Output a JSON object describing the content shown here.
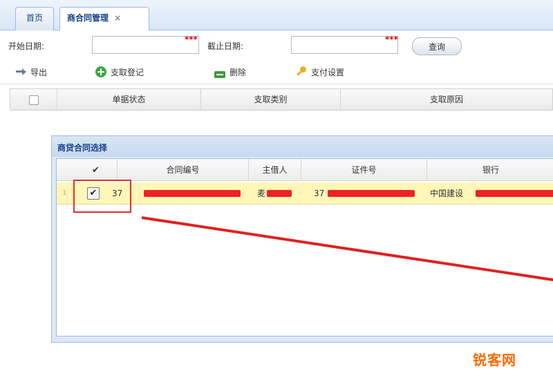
{
  "tabs": [
    {
      "label": "首页"
    },
    {
      "label": "商合同管理",
      "close": "×"
    }
  ],
  "search": {
    "start_label": "开始日期:",
    "end_label": "截止日期:",
    "start_value": "",
    "end_value": "",
    "required_mark": "***",
    "query_label": "查询"
  },
  "toolbar": {
    "export": "导出",
    "add": "支取登记",
    "delete": "删除",
    "settings": "支付设置"
  },
  "grid": {
    "columns": [
      "单据状态",
      "支取类别",
      "支取原因"
    ]
  },
  "dialog": {
    "title": "商贷合同选择",
    "columns": [
      "合同编号",
      "主借人",
      "证件号",
      "银行"
    ],
    "check_header": "✔",
    "rows": [
      {
        "index": "1",
        "checked": "✔",
        "contract_no": "37",
        "borrower": "麦",
        "id_no": "37",
        "bank": "中国建设"
      }
    ]
  },
  "watermark": "锐客网",
  "colors": {
    "accent_red": "#e02020",
    "row_highlight": "#fff6b8",
    "header_blue": "#15428b",
    "watermark": "#ff6a00"
  }
}
